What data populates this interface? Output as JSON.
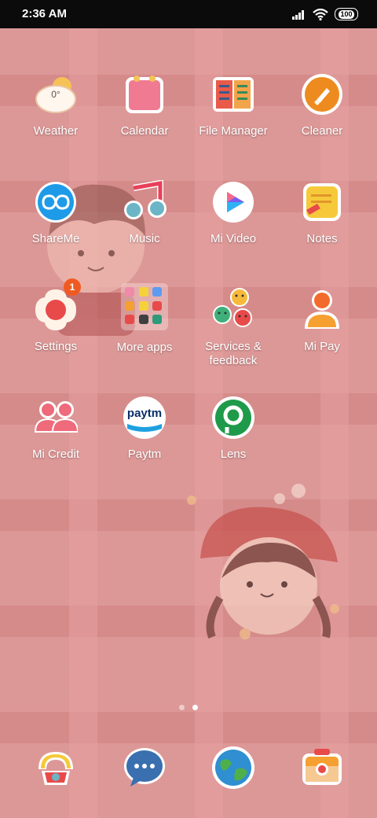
{
  "status": {
    "time": "2:36 AM",
    "battery": "100"
  },
  "weather": {
    "temp": "0°"
  },
  "apps": [
    {
      "label": "Weather"
    },
    {
      "label": "Calendar"
    },
    {
      "label": "File Manager"
    },
    {
      "label": "Cleaner"
    },
    {
      "label": "ShareMe"
    },
    {
      "label": "Music"
    },
    {
      "label": "Mi Video"
    },
    {
      "label": "Notes"
    },
    {
      "label": "Settings",
      "badge": "1"
    },
    {
      "label": "More apps"
    },
    {
      "label": "Services & feedback"
    },
    {
      "label": "Mi Pay"
    },
    {
      "label": "Mi Credit"
    },
    {
      "label": "Paytm"
    },
    {
      "label": "Lens"
    }
  ],
  "paytm_logo_text": "paytm",
  "page_indicator": {
    "pages": 2,
    "active": 2
  },
  "colors": {
    "badge": "#f05a21",
    "wallpaper": "#dc9897"
  }
}
